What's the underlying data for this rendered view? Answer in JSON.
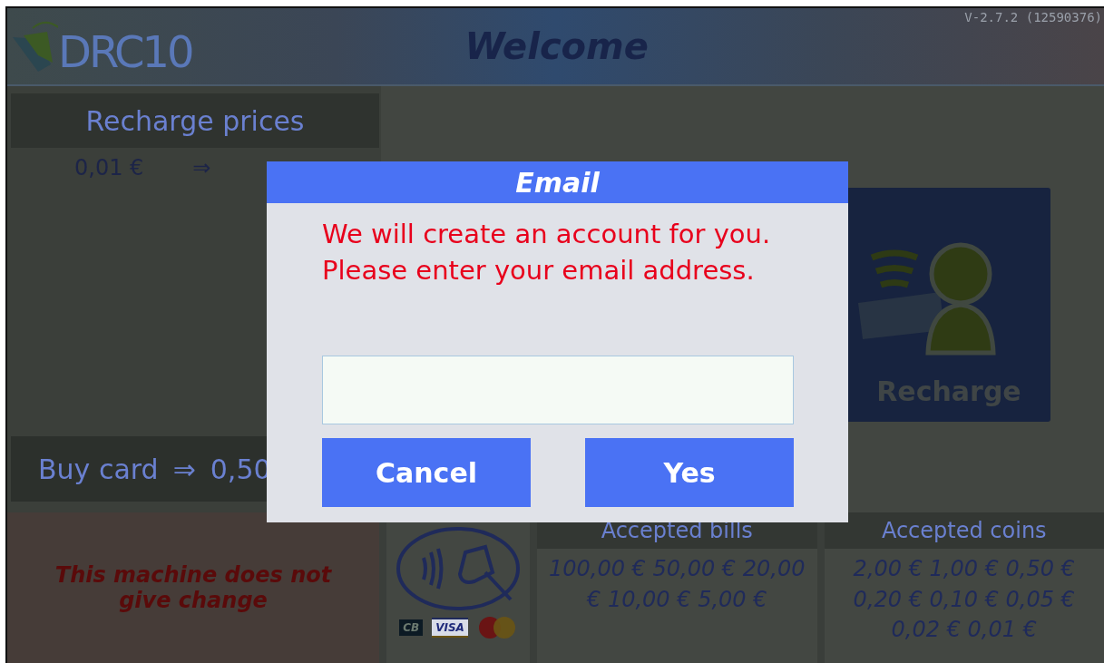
{
  "header": {
    "logo_text": "DRC10",
    "title": "Welcome",
    "version": "V-2.7.2 (12590376)"
  },
  "recharge_prices": {
    "title": "Recharge prices",
    "rows": [
      {
        "amount": "0,01 €",
        "arrow": "⇒"
      }
    ]
  },
  "buy_card": {
    "label": "Buy card",
    "arrow": "⇒",
    "price": "0,50"
  },
  "recharge_tile": {
    "label": "Recharge"
  },
  "notice": "This machine does not give change",
  "card_logos": [
    "CB",
    "VISA"
  ],
  "accepted_bills": {
    "title": "Accepted bills",
    "values": "100,00 € 50,00 € 20,00 € 10,00 € 5,00 €"
  },
  "accepted_coins": {
    "title": "Accepted coins",
    "values": "2,00 € 1,00 € 0,50 € 0,20 € 0,10 € 0,05 € 0,02 € 0,01 €"
  },
  "dialog": {
    "title": "Email",
    "message": "We will create an account for you. Please enter your email address.",
    "buttons": [
      {
        "label": "Cancel"
      },
      {
        "label": "Yes"
      }
    ]
  }
}
